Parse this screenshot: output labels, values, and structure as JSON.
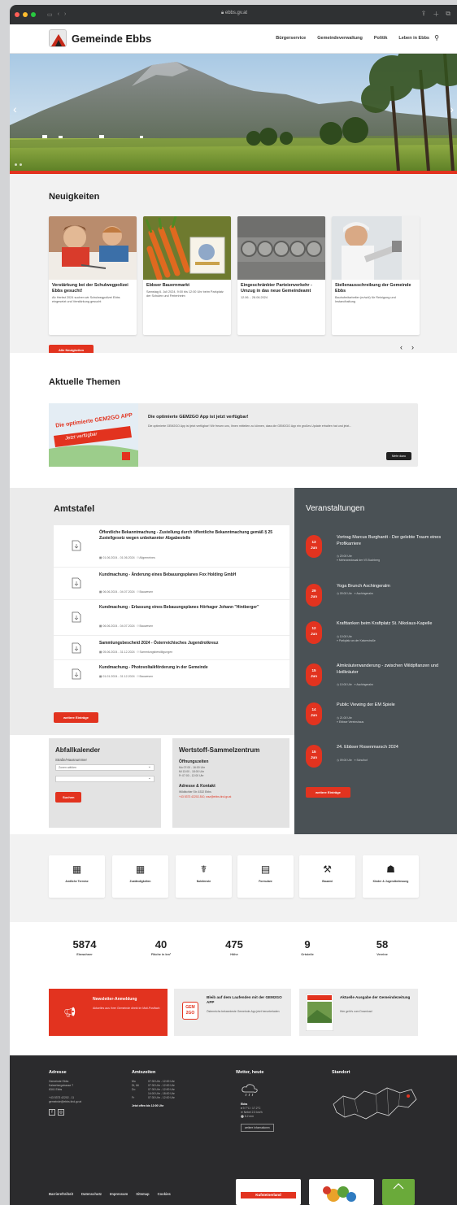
{
  "browser": {
    "url": "ebbs.gv.at"
  },
  "header": {
    "site_name": "Gemeinde Ebbs",
    "nav": [
      "Bürgerservice",
      "Gemeindeverwaltung",
      "Politik",
      "Leben in Ebbs"
    ]
  },
  "news": {
    "heading": "Neuigkeiten",
    "button": "Alle Neuigkeiten",
    "cards": [
      {
        "title": "Verstärkung bei der Schulwegpolizei Ebbs gesucht!",
        "desc": "Ab Herbst 2024 suchen wir Schulwegpolizei Ebbs eingesetzt und Verstärkung gesucht"
      },
      {
        "title": "Ebbser Bauernmarkt",
        "desc": "Samstag 6. Juli 2024, 9:00 bis 12:00 Uhr beim Parkplatz der Schulen und Ferienheim"
      },
      {
        "title": "Eingeschränkter Parteienverkehr - Umzug in das neue Gemeindeamt",
        "desc": "12.06. - 28.06.2024"
      },
      {
        "title": "Stellenausschreibung der Gemeinde Ebbs",
        "desc": "Bauhofmitarbeiter (m/w/d) für Reinigung und Instandhaltung"
      }
    ]
  },
  "themen": {
    "heading": "Aktuelle Themen",
    "card_title": "Die optimierte GEM2GO App ist jetzt verfügbar!",
    "card_text": "Die optimierte GEM2GO App ist jetzt verfügbar! Wir freuen uns, Ihnen mitteilen zu können, dass die GEM2GO App ein großes Update erhalten hat und jetzt...",
    "card_button": "Mehr dazu",
    "promo_title": "Die optimierte GEM2GO APP",
    "promo_sub": "Jetzt verfügbar"
  },
  "amtstafel": {
    "heading": "Amtstafel",
    "button": "weitere Einträge",
    "items": [
      {
        "title": "Öffentliche Bekanntmachung - Zustellung durch öffentliche Bekanntmachung gemäß § 25 Zustellgesetz wegen unbekannter Abgabestelle",
        "date": "01.06.2024 - 01.06.2024",
        "cat": "Allgemeines"
      },
      {
        "title": "Kundmachung - Änderung eines Bebauungsplanes Fox Holding GmbH",
        "date": "06.06.2024 - 04.07.2024",
        "cat": "Bauwesen"
      },
      {
        "title": "Kundmachung - Erlassung eines Bebauungsplanes Hörhager Johann \"Hintberger\"",
        "date": "06.06.2024 - 04.07.2024",
        "cat": "Bauwesen"
      },
      {
        "title": "Sammlungsbescheid 2024 - Österreichisches Jugendrotkreuz",
        "date": "05.06.2024 - 31.12.2024",
        "cat": "Sammlungsbewilligungen"
      },
      {
        "title": "Kundmachung - Photovoltaikförderung in der Gemeinde",
        "date": "01.01.2024 - 31.12.2024",
        "cat": "Bauwesen"
      }
    ]
  },
  "veranstaltungen": {
    "heading": "Veranstaltungen",
    "button": "weitere Einträge",
    "events": [
      {
        "day": "13",
        "month": "Jun",
        "title": "Vortrag Marcus Burghardt - Der gelebte Traum eines Profikarriere",
        "time": "20:00 Uhr",
        "place": "Mehrzwecksaal der VS Buchberg"
      },
      {
        "day": "29",
        "month": "Jun",
        "title": "Yoga Brunch Aschingeralm",
        "time": "09:00 Uhr",
        "place": "Aschingeralm"
      },
      {
        "day": "12",
        "month": "Jun",
        "title": "Krafttanken beim Kraftplatz St. Nikolaus-Kapelle",
        "time": "10:00 Uhr",
        "place": "Parkplatz an der Kaiserstraße"
      },
      {
        "day": "15",
        "month": "Jun",
        "title": "Almkräuterwanderung - zwischen Wildpflanzen und Heilkräuter",
        "time": "10:00 Uhr",
        "place": "Aschingeralm"
      },
      {
        "day": "14",
        "month": "Jun",
        "title": "Public Viewing der EM Spiele",
        "time": "21:00 Uhr",
        "place": "Ebbser Vereinshaus"
      },
      {
        "day": "15",
        "month": "Jun",
        "title": "24. Ebbser Rosenmarsch 2024",
        "time": "09:00 Uhr",
        "place": "Schulhof"
      }
    ]
  },
  "abfall": {
    "heading": "Abfallkalender",
    "label": "Straße/Hausnummer",
    "select1": "Zonen wählen",
    "select2": "",
    "button": "Suchen"
  },
  "wertstoff": {
    "heading": "Wertstoff-Sammelzentrum",
    "sub1": "Öffnungszeiten",
    "hours": [
      "Mo 07:00 - 16:00 Uhr",
      "Mi 13:00 - 18:00 Uhr",
      "Fr 07:00 - 12:00 Uhr"
    ],
    "sub2": "Adresse & Kontakt",
    "address": "Wildbichler Str. 6332 Ebbs",
    "contact": "+43 5373 42202-510, wsz@ebbs.tirol.gv.at"
  },
  "quicklinks": [
    {
      "label": "Amtliche Termine",
      "icon": "calendar-icon"
    },
    {
      "label": "Zuständigkeiten",
      "icon": "calendar-icon"
    },
    {
      "label": "Notdienste",
      "icon": "stethoscope-icon"
    },
    {
      "label": "Formulare",
      "icon": "document-icon"
    },
    {
      "label": "Bauamt",
      "icon": "wrench-icon"
    },
    {
      "label": "Kinder & Jugendbetreuung",
      "icon": "people-icon"
    }
  ],
  "stats": [
    {
      "value": "5874",
      "label": "Einwohner"
    },
    {
      "value": "40",
      "label": "Fläche in km²"
    },
    {
      "value": "475",
      "label": "Höhe"
    },
    {
      "value": "9",
      "label": "Ortsteile"
    },
    {
      "value": "58",
      "label": "Vereine"
    }
  ],
  "promos": {
    "newsletter_title": "Newsletter-Anmeldung",
    "newsletter_text": "Aktuelles aus Ihrer Gemeinde direkt im Mail-Postfach",
    "gem_title": "Bleib auf dem Laufenden mit der GEM2GO APP",
    "gem_text": "Österreichs bekannteste Gemeinde-App jetzt herunterladen",
    "gem_logo": "GEM 2GO",
    "zeitung_title": "Aktuelle Ausgabe der Gemeindezeitung",
    "zeitung_text": "Hier geht's zum Download"
  },
  "footer": {
    "adresse_h": "Adresse",
    "adresse": [
      "Gemeinde Ebbs",
      "Kaiserbergstrasse 7",
      "6341 Ebbs",
      "",
      "+43 5373 42202 - 11",
      "gemeinde@ebbs.tirol.gv.at"
    ],
    "zeiten_h": "Amtszeiten",
    "zeiten": [
      [
        "Mo",
        "07:30 Uhr - 12:00 Uhr"
      ],
      [
        "Di, Mi",
        "07:30 Uhr - 12:00 Uhr"
      ],
      [
        "Do",
        "07:30 Uhr - 12:00 Uhr"
      ],
      [
        "",
        "14:00 Uhr - 18:00 Uhr"
      ],
      [
        "Fr",
        "07:30 Uhr - 12:00 Uhr"
      ]
    ],
    "zeiten_note": "Jetzt offen bis 12:00 Uhr",
    "wetter_h": "Wetter, heute",
    "wetter_place": "Ebbs",
    "wetter": [
      "9.7°C / 17.2°C",
      "Nebel 2.3 km/h",
      "5.2 mm"
    ],
    "wetter_button": "weitere Informationen",
    "standort_h": "Standort",
    "links": [
      "Barrierefreiheit",
      "Datenschutz",
      "Impressum",
      "Sitemap",
      "Cookies"
    ],
    "logo_kufstein": "Kufsteinerland"
  },
  "colors": {
    "accent": "#e2331f",
    "dark": "#4a5155",
    "footer": "#2b2b2d"
  }
}
